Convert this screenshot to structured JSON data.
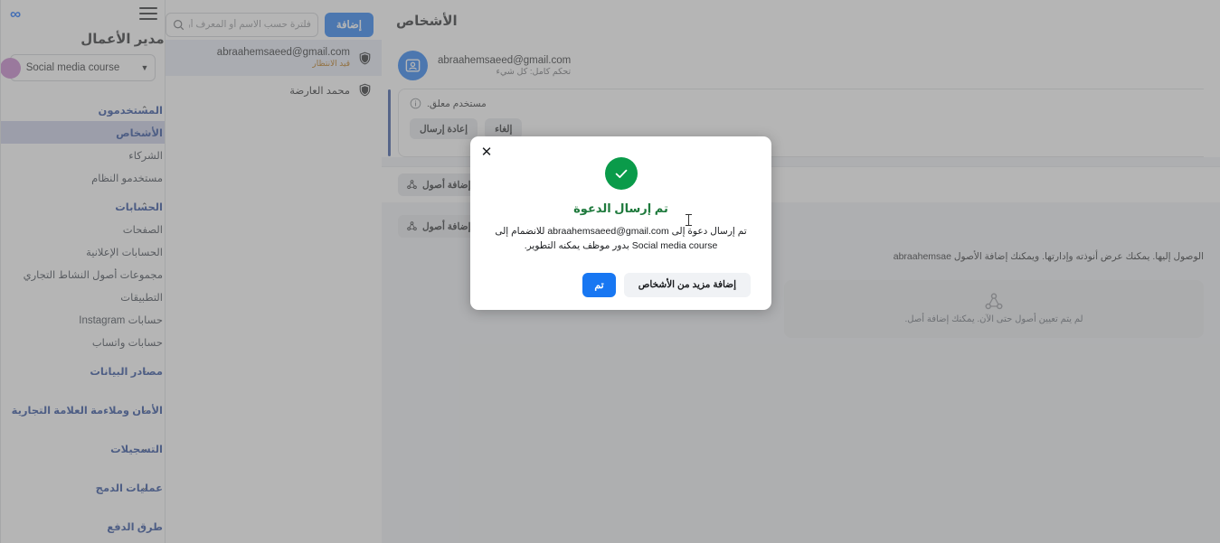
{
  "sidebar": {
    "logo": "meta-infinity",
    "menu_icon": "hamburger-icon",
    "title": "ات مدير الأعمال",
    "business_selector": {
      "name": "Social media course",
      "chevron": "chevron-down-icon"
    },
    "groups": [
      {
        "label": "المستخدمون",
        "caret": "chevron-up-icon",
        "items": [
          {
            "label": "الأشخاص",
            "active": true
          },
          {
            "label": "الشركاء",
            "active": false
          },
          {
            "label": "مستخدمو النظام",
            "active": false
          }
        ]
      },
      {
        "label": "الحسابات",
        "caret": "chevron-up-icon",
        "items": [
          {
            "label": "الصفحات",
            "active": false
          },
          {
            "label": "الحسابات الإعلانية",
            "active": false
          },
          {
            "label": "مجموعات أصول النشاط التجاري",
            "active": false
          },
          {
            "label": "التطبيقات",
            "active": false
          },
          {
            "label": "حسابات Instagram",
            "active": false
          },
          {
            "label": "حسابات واتساب",
            "active": false
          }
        ]
      },
      {
        "label": "مصادر البيانات",
        "caret": "chevron-down-icon",
        "items": []
      },
      {
        "label": "الأمان وملاءمة العلامة التجارية",
        "caret": "chevron-down-icon",
        "items": []
      },
      {
        "label": "التسجيلات",
        "caret": "chevron-down-icon",
        "items": []
      },
      {
        "label": "عمليات الدمج",
        "caret": "chevron-down-icon",
        "items": []
      },
      {
        "label": "طرق الدفع",
        "caret": "",
        "items": []
      }
    ]
  },
  "people_panel": {
    "add_button": "إضافة",
    "search_placeholder": "فلترة حسب الاسم أو المعرف أو البريد...",
    "search_value": "",
    "search_icon": "search-icon",
    "rows": [
      {
        "name": "abraahemsaeed@gmail.com",
        "status": "قيد الانتظار",
        "selected": true,
        "icon": "shield-icon"
      },
      {
        "name": "محمد العارضة",
        "status": "",
        "selected": false,
        "icon": "shield-icon"
      }
    ]
  },
  "detail": {
    "page_title": "الأشخاص",
    "user": {
      "email": "abraahemsaeed@gmail.com",
      "role": "تحكم كامل: كل شيء",
      "avatar_icon": "contact-card-icon"
    },
    "pending": {
      "info_icon": "info-icon",
      "text": "مستخدم معلق.",
      "resend_button": "إعادة إرسال",
      "cancel_button": "إلغاء"
    },
    "assets": {
      "add_asset_button_top": "إضافة أصول",
      "add_asset_button_inline": "إضافة أصول",
      "asset_icon": "assets-icon",
      "description": "الوصول إليها. يمكنك عرض أنوذته وإدارتها. ويمكنك إضافة الأصول abraahemsae",
      "empty_icon": "assets-icon",
      "empty_text": "لم يتم تعيين أصول حتى الآن. يمكنك إضافة أصل."
    }
  },
  "modal": {
    "close_icon": "close-icon",
    "success_icon": "check-icon",
    "title": "تم إرسال الدعوة",
    "description": "تم إرسال دعوة إلى abraahemsaeed@gmail.com للانضمام إلى Social media course بدور موظف يمكنه التطوير.",
    "primary_button": "تم",
    "secondary_button": "إضافة مزيد من الأشخاص"
  },
  "colors": {
    "brand_blue": "#1877f2",
    "meta_logo": "#0866ff",
    "success_green": "#0a9b4a",
    "title_green": "#1f7a3d",
    "pending_orange": "#b26a00",
    "accent_bar": "#2d4f9e",
    "active_nav_bg": "#c7cde6",
    "nav_active_text": "#1c3f94"
  }
}
